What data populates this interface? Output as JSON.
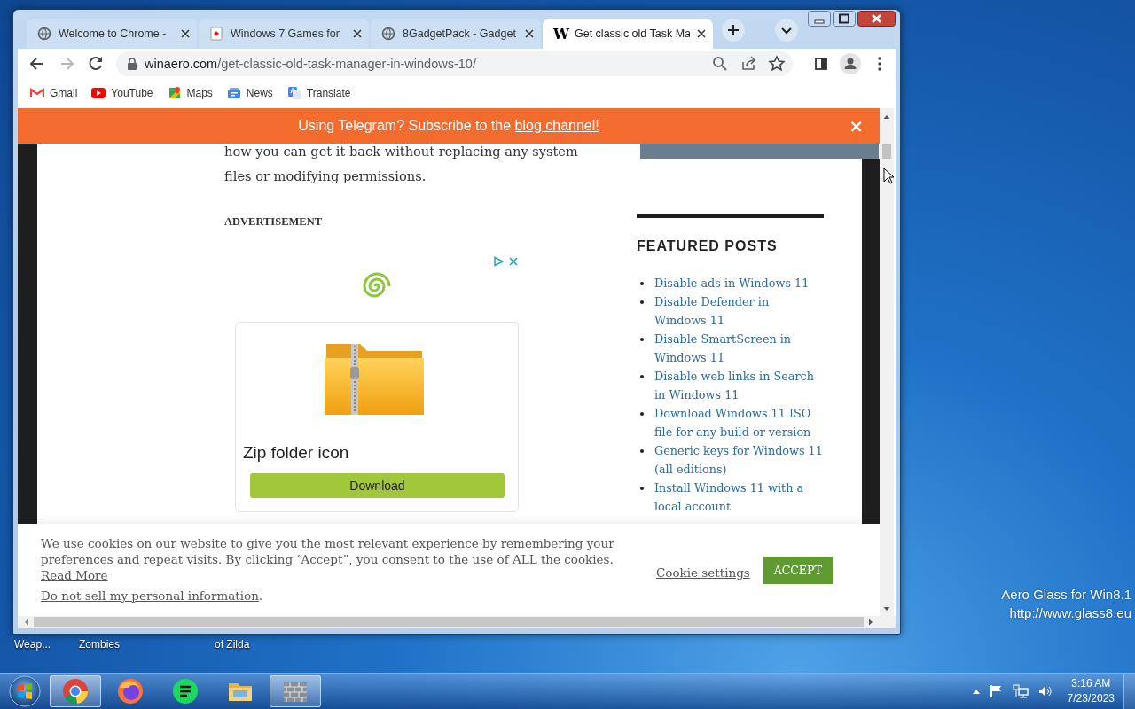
{
  "desktop": {
    "icon_labels": [
      {
        "label": "Weap..."
      },
      {
        "label": "Zombies"
      },
      {
        "label": "of Zilda"
      }
    ],
    "corner_text": [
      "Aero Glass for Win8.1",
      "http://www.glass8.eu"
    ]
  },
  "browser": {
    "tabs": [
      {
        "title": "Welcome to Chrome -",
        "kind": "globe",
        "selected": false
      },
      {
        "title": "Windows 7 Games for",
        "kind": "cards",
        "selected": false
      },
      {
        "title": "8GadgetPack - Gadget",
        "kind": "globe",
        "selected": false
      },
      {
        "title": "Get classic old Task Ma",
        "kind": "letter",
        "favicon_text": "W",
        "selected": true
      }
    ],
    "nav": [
      {
        "kind": "back",
        "disabled": false
      },
      {
        "kind": "forward",
        "disabled": true
      },
      {
        "kind": "reload",
        "disabled": false
      }
    ],
    "address": {
      "host": "winaero.com",
      "path": "/get-classic-old-task-manager-in-windows-10/"
    },
    "bookmarks": [
      {
        "label": "Gmail",
        "kind": "gmail"
      },
      {
        "label": "YouTube",
        "kind": "youtube"
      },
      {
        "label": "Maps",
        "kind": "maps"
      },
      {
        "label": "News",
        "kind": "news"
      },
      {
        "label": "Translate",
        "kind": "translate"
      }
    ]
  },
  "page": {
    "banner": {
      "text": "Using Telegram? Subscribe to the ",
      "link": "blog channel!",
      "close": "×"
    },
    "article": {
      "paragraph": "how you can get it back without replacing any system files or modifying permissions.",
      "ad_label": "ADVERTISEMENT",
      "ad": {
        "title": "Zip folder icon",
        "button": "Download"
      }
    },
    "sidebar": {
      "heading": "FEATURED POSTS",
      "posts": [
        "Disable ads in Windows 11",
        "Disable Defender in Windows 11",
        "Disable SmartScreen in Windows 11",
        "Disable web links in Search in Windows 11",
        "Download Windows 11 ISO file for any build or version",
        "Generic keys for Windows 11 (all editions)",
        "Install Windows 11 with a local account"
      ]
    },
    "cookie_bar": {
      "text": "We use cookies on our website to give you the most relevant experience by remembering your preferences and repeat visits. By clicking “Accept”, you consent to the use of ALL the cookies. ",
      "read_more": "Read More",
      "do_not_sell": "Do not sell my personal information",
      "do_not_sell_suffix": ".",
      "settings": "Cookie settings",
      "accept": "ACCEPT"
    }
  },
  "taskbar": {
    "apps": [
      {
        "kind": "chrome",
        "open": true
      },
      {
        "kind": "firefox",
        "open": false
      },
      {
        "kind": "green-app",
        "open": false
      },
      {
        "kind": "folder",
        "open": false
      },
      {
        "kind": "wall",
        "open": true
      }
    ],
    "clock": {
      "time": "3:16 AM",
      "date": "7/23/2023"
    }
  }
}
